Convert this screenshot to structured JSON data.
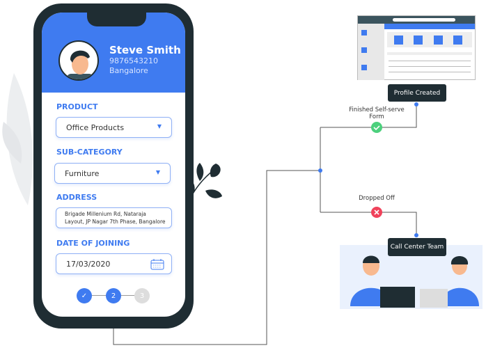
{
  "profile": {
    "name": "Steve Smith",
    "phone": "9876543210",
    "city": "Bangalore"
  },
  "form": {
    "product": {
      "label": "PRODUCT",
      "value": "Office Products"
    },
    "subcategory": {
      "label": "SUB-CATEGORY",
      "value": "Furniture"
    },
    "address": {
      "label": "ADDRESS",
      "value_line1": "Brigade Millenium Rd, Nataraja",
      "value_line2": "Layout, JP Nagar 7th Phase, Bangalore"
    },
    "date": {
      "label": "DATE OF JOINING",
      "value": "17/03/2020"
    }
  },
  "steps": [
    {
      "label": "✓",
      "state": "done"
    },
    {
      "label": "2",
      "state": "active"
    },
    {
      "label": "3",
      "state": "pending"
    }
  ],
  "flow": {
    "profile_created": "Profile Created",
    "finished_label": "Finished Self-serve Form",
    "dropped_label": "Dropped Off",
    "call_center": "Call Center Team"
  },
  "colors": {
    "accent": "#3f7bf0",
    "dark": "#1f2d33",
    "success": "#4cd07d",
    "danger": "#f0425b"
  }
}
